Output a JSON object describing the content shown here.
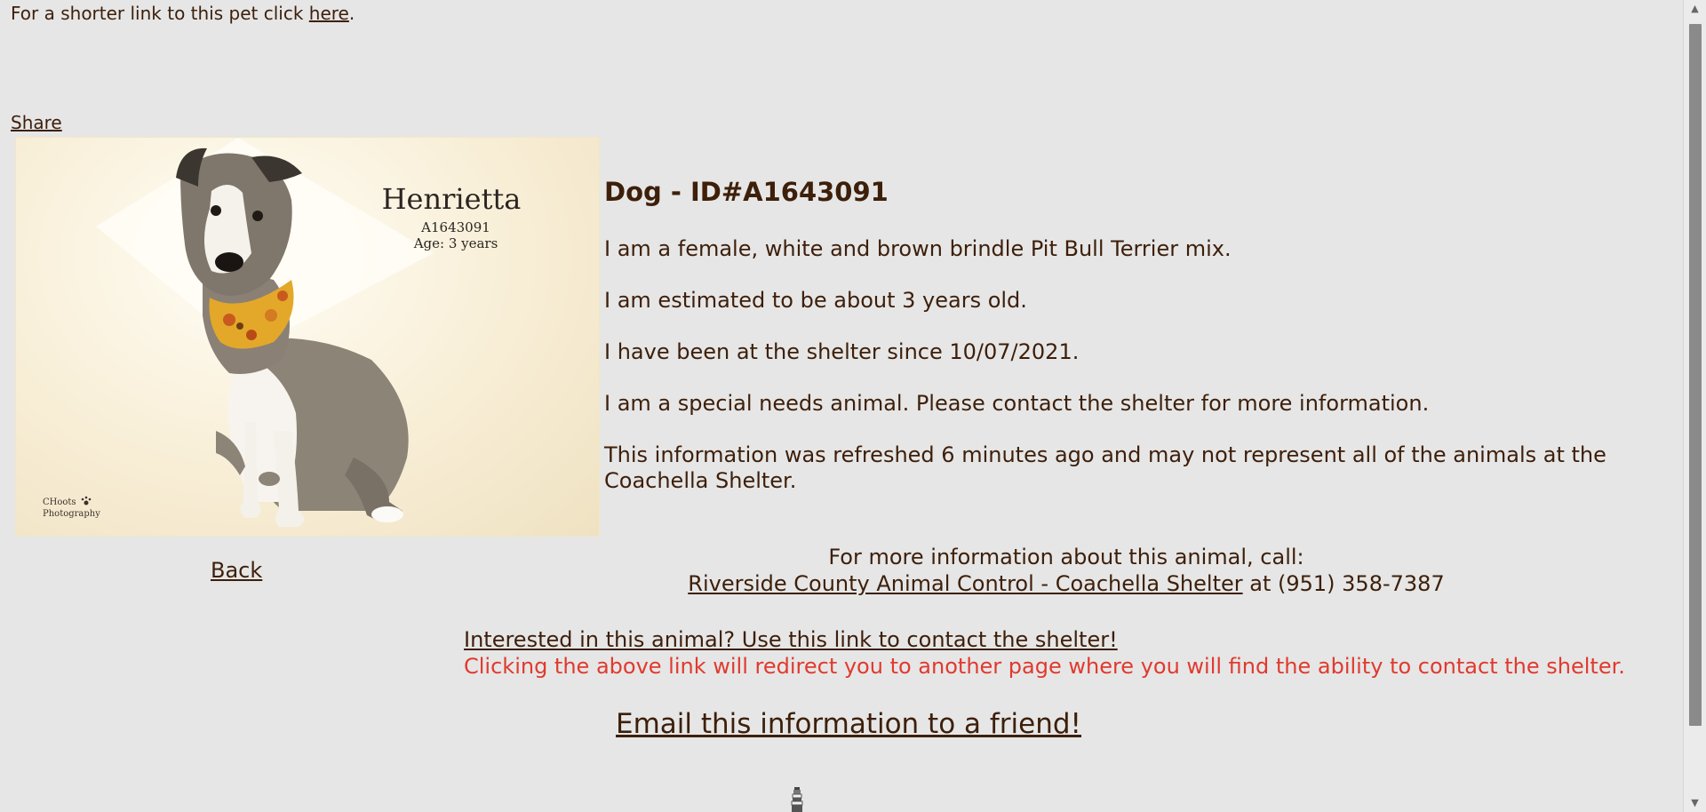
{
  "short_link": {
    "prefix": "For a shorter link to this pet click ",
    "link_text": "here",
    "suffix": "."
  },
  "share_label": "Share",
  "photo": {
    "name": "Henrietta",
    "id": "A1643091",
    "age": "Age: 3 years",
    "credit_line1": "CHoots",
    "credit_line2": "Photography"
  },
  "back_label": "Back",
  "details": {
    "heading": "Dog - ID#A1643091",
    "lines": [
      "I am a female, white and brown brindle Pit Bull Terrier mix.",
      "I am estimated to be about 3 years old.",
      "I have been at the shelter since 10/07/2021.",
      "I am a special needs animal. Please contact the shelter for more information.",
      "This information was refreshed 6 minutes ago and may not represent all of the animals at the Coachella Shelter."
    ]
  },
  "contact": {
    "intro": "For more information about this animal, call:",
    "shelter_link": "Riverside County Animal Control - Coachella Shelter",
    "phone_text": " at (951) 358-7387"
  },
  "interest": {
    "link_text": "Interested in this animal? Use this link to contact the shelter!",
    "note": "Clicking the above link will redirect you to another page where you will find the ability to contact the shelter."
  },
  "email_label": "Email this information to a friend!",
  "icons": {
    "bottom": "lighthouse-icon",
    "scroll_up": "chevron-up-icon",
    "scroll_down": "chevron-down-icon"
  },
  "colors": {
    "text": "#3d1f0a",
    "background": "#e6e6e6",
    "warning": "#e03a2e"
  }
}
